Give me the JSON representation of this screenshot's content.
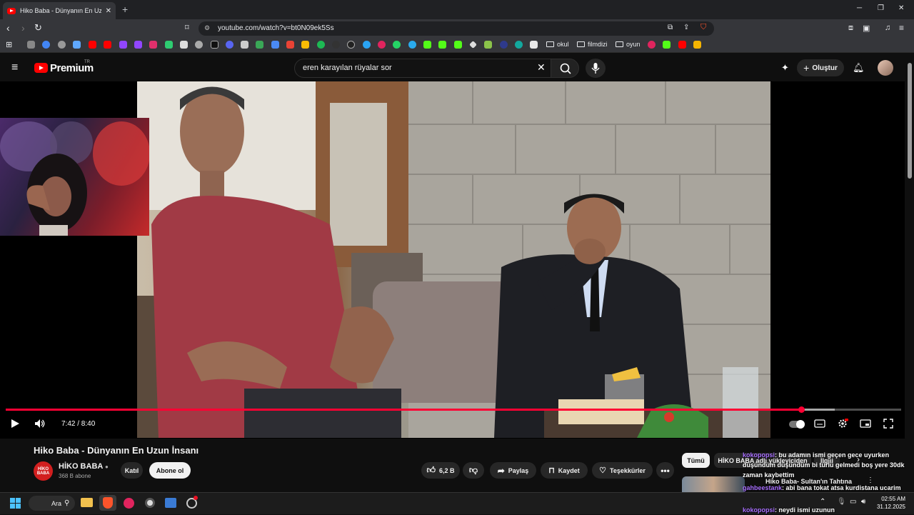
{
  "browser": {
    "tab_title": "Hiko Baba - Dünyanın En Uzun İ",
    "url": "youtube.com/watch?v=bt0N09ek5Ss",
    "bookmark_folders": [
      "okul",
      "filmdizi",
      "oyun"
    ]
  },
  "youtube": {
    "logo_text": "Premium",
    "country": "TR",
    "search_query": "eren karayılan rüyalar sor",
    "create_label": "Oluştur"
  },
  "player": {
    "current_time": "7:42",
    "duration": "8:40",
    "time_display": "7:42 / 8:40",
    "progress_fraction": 0.889,
    "buffered_fraction": 0.926
  },
  "video": {
    "title": "Hiko Baba - Dünyanın En Uzun İnsanı",
    "channel_name": "HİKO BABA",
    "channel_avatar_text": "HİKO BABA",
    "subscribers": "368 B abone",
    "join_label": "Katıl",
    "subscribe_label": "Abone ol",
    "likes": "6,2 B",
    "share_label": "Paylaş",
    "save_label": "Kaydet",
    "thanks_label": "Teşekkürler"
  },
  "sidebar": {
    "chips": [
      "Tümü",
      "HİKO BABA adlı yükleyiciden",
      "İlgili"
    ],
    "next_video_title": "Hiko Baba- Sultan'ın Tahtına"
  },
  "chat_overlay": [
    {
      "user": "kokopopsi",
      "text": ": bu adamın ismi geçen gece uyurken düşündüm düşündüm bi türlü gelmedi boş yere 30dk zaman kaybettim"
    },
    {
      "user": "gahbeestank",
      "text": ": abi bana tokat atsa kurdistana ucarim amk"
    },
    {
      "user": "kokopopsi",
      "text": ": neydi ismi uzunun"
    }
  ],
  "taskbar": {
    "search_label": "Ara",
    "time": "02:55 AM",
    "date": "31.12.2025"
  },
  "colors": {
    "youtube_red": "#ff0000",
    "progress_red": "#ff0033",
    "chat_username": "#a970ff"
  }
}
